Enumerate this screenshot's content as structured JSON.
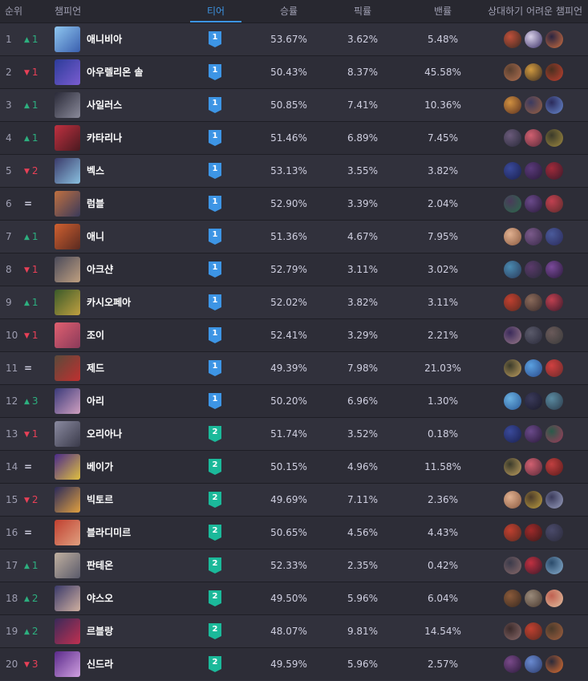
{
  "header": {
    "rank": "순위",
    "champion": "챔피언",
    "tier": "티어",
    "win_rate": "승률",
    "pick_rate": "픽률",
    "ban_rate": "밴률",
    "counters": "상대하기 어려운 챔피언"
  },
  "colors": {
    "tier1": "#3d95e5",
    "tier2": "#1bb99a",
    "up": "#2daf7f",
    "down": "#e84057"
  },
  "rows": [
    {
      "rank": "1",
      "dir": "up",
      "change": "1",
      "name": "애니비아",
      "tier": "1",
      "win": "53.67%",
      "pick": "3.62%",
      "ban": "5.48%",
      "portrait": [
        "#8fc7f0",
        "#3a5fae"
      ],
      "counters": [
        [
          "#c0503a",
          "#3b2a22"
        ],
        [
          "#d8d0e8",
          "#3a2f66"
        ],
        [
          "#2a2440",
          "#d07040"
        ]
      ]
    },
    {
      "rank": "2",
      "dir": "down",
      "change": "1",
      "name": "아우렐리온 솔",
      "tier": "1",
      "win": "50.43%",
      "pick": "8.37%",
      "ban": "45.58%",
      "portrait": [
        "#2c3c9a",
        "#7a5cd0"
      ],
      "counters": [
        [
          "#5a4030",
          "#b07050"
        ],
        [
          "#d09a40",
          "#3a2a20"
        ],
        [
          "#4a3020",
          "#c04030"
        ]
      ]
    },
    {
      "rank": "3",
      "dir": "up",
      "change": "1",
      "name": "사일러스",
      "tier": "1",
      "win": "50.85%",
      "pick": "7.41%",
      "ban": "10.36%",
      "portrait": [
        "#2a2a38",
        "#8a8a9a"
      ],
      "counters": [
        [
          "#d09040",
          "#5a3020"
        ],
        [
          "#3a3a60",
          "#9a6040"
        ],
        [
          "#2a2a5a",
          "#6a8ad0"
        ]
      ]
    },
    {
      "rank": "4",
      "dir": "up",
      "change": "1",
      "name": "카타리나",
      "tier": "1",
      "win": "51.46%",
      "pick": "6.89%",
      "ban": "7.45%",
      "portrait": [
        "#c03040",
        "#4a1a20"
      ],
      "counters": [
        [
          "#6a5a7a",
          "#2a2a3a"
        ],
        [
          "#d06070",
          "#5a2a3a"
        ],
        [
          "#3a3a2a",
          "#a08a40"
        ]
      ]
    },
    {
      "rank": "5",
      "dir": "down",
      "change": "2",
      "name": "벡스",
      "tier": "1",
      "win": "53.13%",
      "pick": "3.55%",
      "ban": "3.82%",
      "portrait": [
        "#3a3a6a",
        "#8ac0e0"
      ],
      "counters": [
        [
          "#3a4a9a",
          "#1a2050"
        ],
        [
          "#5a3a7a",
          "#2a1a3a"
        ],
        [
          "#a02a3a",
          "#3a1a2a"
        ]
      ]
    },
    {
      "rank": "6",
      "dir": "same",
      "change": "=",
      "name": "럼블",
      "tier": "1",
      "win": "52.90%",
      "pick": "3.39%",
      "ban": "2.04%",
      "portrait": [
        "#c07040",
        "#3a3a5a"
      ],
      "counters": [
        [
          "#4a3a5a",
          "#2a6a4a"
        ],
        [
          "#6a4a8a",
          "#2a1a3a"
        ],
        [
          "#c04050",
          "#5a2a2a"
        ]
      ]
    },
    {
      "rank": "7",
      "dir": "up",
      "change": "1",
      "name": "애니",
      "tier": "1",
      "win": "51.36%",
      "pick": "4.67%",
      "ban": "7.95%",
      "portrait": [
        "#d06030",
        "#5a2a20"
      ],
      "counters": [
        [
          "#e0b090",
          "#8a5a40"
        ],
        [
          "#7a5a8a",
          "#3a2a4a"
        ],
        [
          "#4a5a9a",
          "#2a2a5a"
        ]
      ]
    },
    {
      "rank": "8",
      "dir": "down",
      "change": "1",
      "name": "아크샨",
      "tier": "1",
      "win": "52.79%",
      "pick": "3.11%",
      "ban": "3.02%",
      "portrait": [
        "#4a4a5a",
        "#c0a080"
      ],
      "counters": [
        [
          "#4a8ab0",
          "#2a3a5a"
        ],
        [
          "#5a3a6a",
          "#2a2a3a"
        ],
        [
          "#7a4a9a",
          "#2a1a3a"
        ]
      ]
    },
    {
      "rank": "9",
      "dir": "up",
      "change": "1",
      "name": "카시오페아",
      "tier": "1",
      "win": "52.02%",
      "pick": "3.82%",
      "ban": "3.11%",
      "portrait": [
        "#3a5a2a",
        "#c0a040"
      ],
      "counters": [
        [
          "#c04030",
          "#5a2a20"
        ],
        [
          "#8a6a5a",
          "#3a2a2a"
        ],
        [
          "#c04050",
          "#3a1a2a"
        ]
      ]
    },
    {
      "rank": "10",
      "dir": "down",
      "change": "1",
      "name": "조이",
      "tier": "1",
      "win": "52.41%",
      "pick": "3.29%",
      "ban": "2.21%",
      "portrait": [
        "#e06070",
        "#8a3a5a"
      ],
      "counters": [
        [
          "#3a2a5a",
          "#9a7a8a"
        ],
        [
          "#5a5a6a",
          "#2a2a3a"
        ],
        [
          "#6a5a5a",
          "#3a3a3a"
        ]
      ]
    },
    {
      "rank": "11",
      "dir": "same",
      "change": "=",
      "name": "제드",
      "tier": "1",
      "win": "49.39%",
      "pick": "7.98%",
      "ban": "21.03%",
      "portrait": [
        "#5a4a3a",
        "#c03030"
      ],
      "counters": [
        [
          "#3a3a2a",
          "#c0a060"
        ],
        [
          "#5aa0e0",
          "#2a4a8a"
        ],
        [
          "#d04040",
          "#6a2a2a"
        ]
      ]
    },
    {
      "rank": "12",
      "dir": "up",
      "change": "3",
      "name": "아리",
      "tier": "1",
      "win": "50.20%",
      "pick": "6.96%",
      "ban": "1.30%",
      "portrait": [
        "#3a3a7a",
        "#d0a0c0"
      ],
      "counters": [
        [
          "#6ab0e0",
          "#2a5a9a"
        ],
        [
          "#3a3a5a",
          "#1a1a2a"
        ],
        [
          "#5a8aa0",
          "#2a3a4a"
        ]
      ]
    },
    {
      "rank": "13",
      "dir": "down",
      "change": "1",
      "name": "오리아나",
      "tier": "2",
      "win": "51.74%",
      "pick": "3.52%",
      "ban": "0.18%",
      "portrait": [
        "#8a8aa0",
        "#3a3a4a"
      ],
      "counters": [
        [
          "#3a4a9a",
          "#1a2050"
        ],
        [
          "#6a4a8a",
          "#2a1a3a"
        ],
        [
          "#2a5a4a",
          "#a03a5a"
        ]
      ]
    },
    {
      "rank": "14",
      "dir": "same",
      "change": "=",
      "name": "베이가",
      "tier": "2",
      "win": "50.15%",
      "pick": "4.96%",
      "ban": "11.58%",
      "portrait": [
        "#4a2a8a",
        "#e0c040"
      ],
      "counters": [
        [
          "#3a3a2a",
          "#c0a060"
        ],
        [
          "#d06070",
          "#5a2a3a"
        ],
        [
          "#c04040",
          "#5a1a1a"
        ]
      ]
    },
    {
      "rank": "15",
      "dir": "down",
      "change": "2",
      "name": "빅토르",
      "tier": "2",
      "win": "49.69%",
      "pick": "7.11%",
      "ban": "2.36%",
      "portrait": [
        "#2a2a5a",
        "#e0a040"
      ],
      "counters": [
        [
          "#e0b090",
          "#8a5a40"
        ],
        [
          "#4a3a2a",
          "#c0a040"
        ],
        [
          "#3a3a5a",
          "#9aa0c0"
        ]
      ]
    },
    {
      "rank": "16",
      "dir": "same",
      "change": "=",
      "name": "블라디미르",
      "tier": "2",
      "win": "50.65%",
      "pick": "4.56%",
      "ban": "4.43%",
      "portrait": [
        "#c04030",
        "#e0a080"
      ],
      "counters": [
        [
          "#c04030",
          "#5a2a20"
        ],
        [
          "#a02a2a",
          "#3a1a1a"
        ],
        [
          "#4a4a6a",
          "#2a2a3a"
        ]
      ]
    },
    {
      "rank": "17",
      "dir": "up",
      "change": "1",
      "name": "판테온",
      "tier": "2",
      "win": "52.33%",
      "pick": "2.35%",
      "ban": "0.42%",
      "portrait": [
        "#c0b0a0",
        "#5a5a6a"
      ],
      "counters": [
        [
          "#3a3a4a",
          "#8a6a6a"
        ],
        [
          "#c03040",
          "#3a1a2a"
        ],
        [
          "#2a4a6a",
          "#8ab0d0"
        ]
      ]
    },
    {
      "rank": "18",
      "dir": "up",
      "change": "2",
      "name": "야스오",
      "tier": "2",
      "win": "49.50%",
      "pick": "5.96%",
      "ban": "6.04%",
      "portrait": [
        "#3a3a6a",
        "#d0b0a0"
      ],
      "counters": [
        [
          "#8a5a3a",
          "#3a2a20"
        ],
        [
          "#9a8a7a",
          "#4a3a30"
        ],
        [
          "#c06050",
          "#e0c0a0"
        ]
      ]
    },
    {
      "rank": "19",
      "dir": "up",
      "change": "2",
      "name": "르블랑",
      "tier": "2",
      "win": "48.07%",
      "pick": "9.81%",
      "ban": "14.54%",
      "portrait": [
        "#3a2a5a",
        "#c03050"
      ],
      "counters": [
        [
          "#3a2a2a",
          "#8a6a6a"
        ],
        [
          "#c04030",
          "#5a2a20"
        ],
        [
          "#4a3a2a",
          "#a06040"
        ]
      ]
    },
    {
      "rank": "20",
      "dir": "down",
      "change": "3",
      "name": "신드라",
      "tier": "2",
      "win": "49.59%",
      "pick": "5.96%",
      "ban": "2.57%",
      "portrait": [
        "#5a2a8a",
        "#d0a0e0"
      ],
      "counters": [
        [
          "#7a4a8a",
          "#2a1a3a"
        ],
        [
          "#6a8ad0",
          "#2a3a6a"
        ],
        [
          "#2a2a3a",
          "#e07030"
        ]
      ]
    }
  ]
}
